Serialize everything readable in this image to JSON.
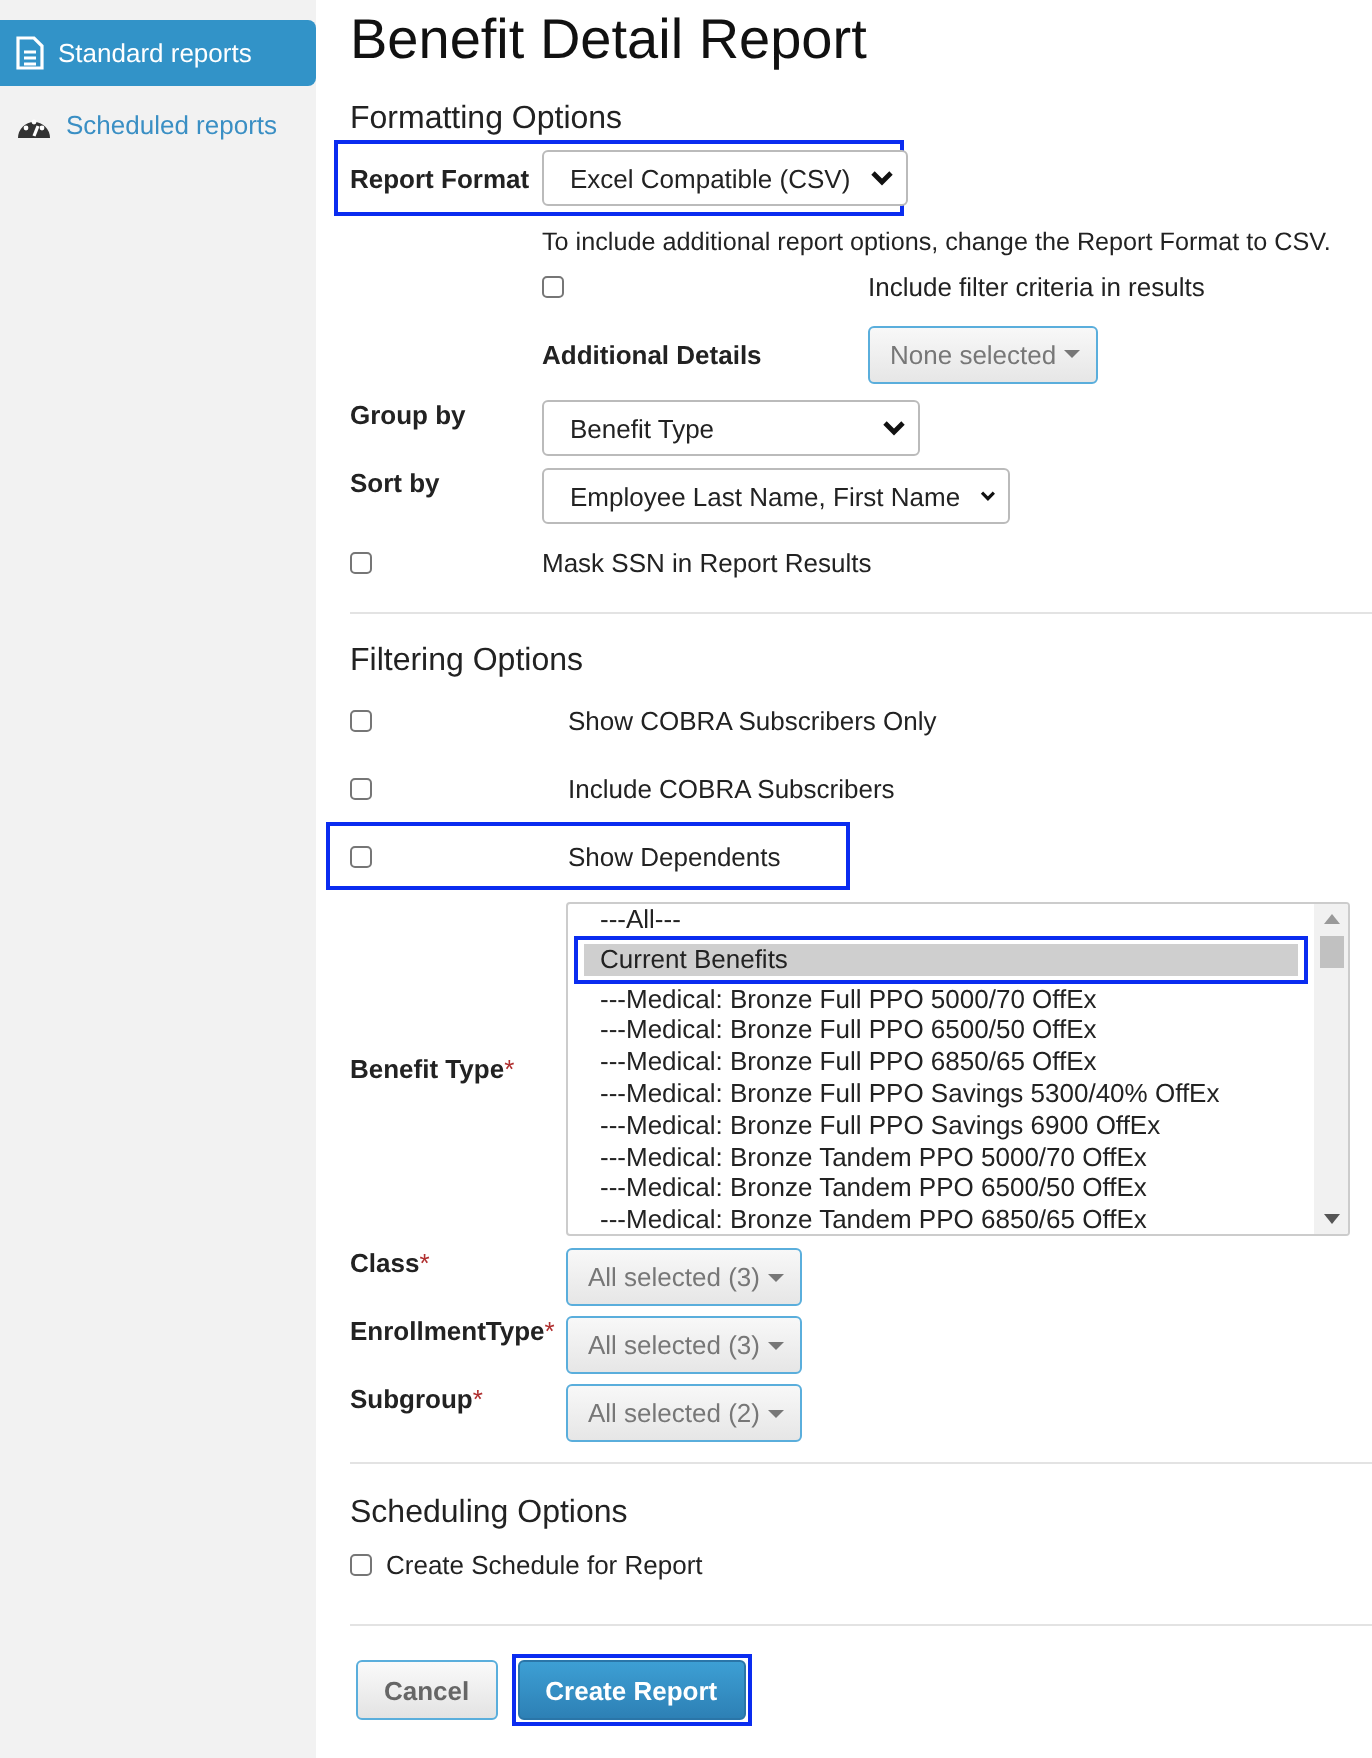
{
  "sidebar": {
    "items": [
      {
        "label": "Standard reports",
        "selected": true
      },
      {
        "label": "Scheduled reports",
        "selected": false
      }
    ]
  },
  "page_title": "Benefit Detail Report",
  "formatting": {
    "heading": "Formatting Options",
    "report_format": {
      "label": "Report Format",
      "value": "Excel Compatible (CSV)",
      "highlighted": true
    },
    "note": "To include additional report options, change the Report Format to CSV.",
    "include_filter_criteria": {
      "label": "Include filter criteria in results",
      "checked": false
    },
    "additional_details": {
      "label": "Additional Details",
      "value": "None selected"
    },
    "group_by": {
      "label": "Group by",
      "value": "Benefit Type"
    },
    "sort_by": {
      "label": "Sort by",
      "value": "Employee Last Name, First Name"
    },
    "mask_ssn": {
      "label": "Mask SSN in Report Results",
      "checked": false
    }
  },
  "filtering": {
    "heading": "Filtering Options",
    "checkboxes": [
      {
        "label": "Show COBRA Subscribers Only",
        "checked": false,
        "highlighted": false
      },
      {
        "label": "Include COBRA Subscribers",
        "checked": false,
        "highlighted": false
      },
      {
        "label": "Show Dependents",
        "checked": false,
        "highlighted": true
      }
    ],
    "benefit_type": {
      "label": "Benefit Type",
      "required_mark": "*",
      "options": [
        {
          "label": "---All---",
          "selected": false,
          "highlighted": false
        },
        {
          "label": "Current Benefits",
          "selected": true,
          "highlighted": true
        },
        {
          "label": "---Medical: Bronze Full PPO 5000/70 OffEx",
          "selected": false,
          "highlighted": false
        },
        {
          "label": "---Medical: Bronze Full PPO 6500/50 OffEx",
          "selected": false,
          "highlighted": false
        },
        {
          "label": "---Medical: Bronze Full PPO 6850/65 OffEx",
          "selected": false,
          "highlighted": false
        },
        {
          "label": "---Medical: Bronze Full PPO Savings 5300/40% OffEx",
          "selected": false,
          "highlighted": false
        },
        {
          "label": "---Medical: Bronze Full PPO Savings 6900 OffEx",
          "selected": false,
          "highlighted": false
        },
        {
          "label": "---Medical: Bronze Tandem PPO 5000/70 OffEx",
          "selected": false,
          "highlighted": false
        },
        {
          "label": "---Medical: Bronze Tandem PPO 6500/50 OffEx",
          "selected": false,
          "highlighted": false
        },
        {
          "label": "---Medical: Bronze Tandem PPO 6850/65 OffEx",
          "selected": false,
          "highlighted": false
        }
      ]
    },
    "multiselects": [
      {
        "label": "Class",
        "required_mark": "*",
        "value": "All selected (3)"
      },
      {
        "label": "EnrollmentType",
        "required_mark": "*",
        "value": "All selected (3)"
      },
      {
        "label": "Subgroup",
        "required_mark": "*",
        "value": "All selected (2)"
      }
    ]
  },
  "scheduling": {
    "heading": "Scheduling Options",
    "create_schedule": {
      "label": "Create Schedule for Report",
      "checked": false
    }
  },
  "buttons": [
    {
      "label": "Cancel",
      "kind": "secondary",
      "highlighted": false
    },
    {
      "label": "Create Report",
      "kind": "primary",
      "highlighted": true
    }
  ]
}
